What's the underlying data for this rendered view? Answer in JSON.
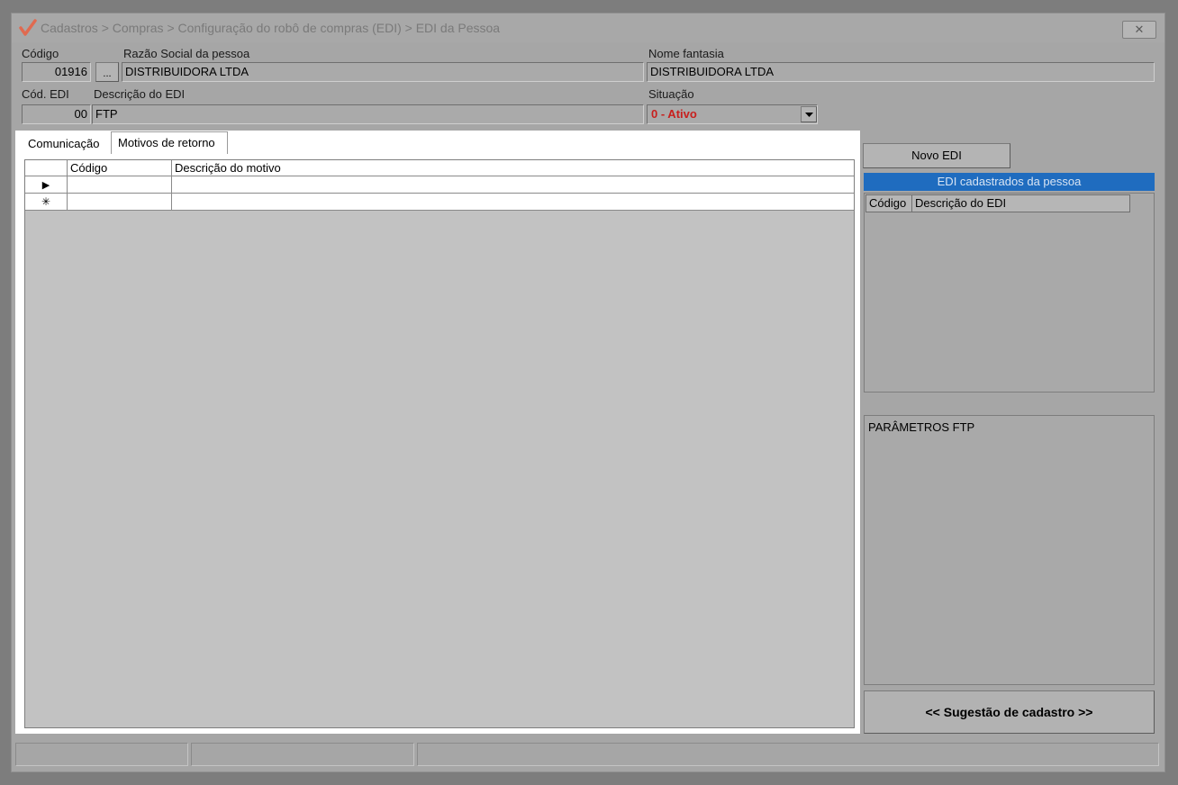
{
  "window": {
    "breadcrumb": "Cadastros > Compras > Configuração do robô de compras (EDI) > EDI da Pessoa",
    "close_label": "✕",
    "accent_color": "#e06a50"
  },
  "form": {
    "codigo_label": "Código",
    "codigo_value": "01916",
    "lookup_label": "...",
    "razao_label": "Razão Social da pessoa",
    "razao_value": "DISTRIBUIDORA LTDA",
    "fantasia_label": "Nome fantasia",
    "fantasia_value": "DISTRIBUIDORA LTDA",
    "cod_edi_label": "Cód. EDI",
    "cod_edi_value": "00",
    "desc_edi_label": "Descrição do EDI",
    "desc_edi_value": "FTP",
    "situacao_label": "Situação",
    "situacao_value": "0 - Ativo",
    "situacao_color": "#c8201e"
  },
  "tabs": [
    {
      "label": "Comunicação",
      "active": false
    },
    {
      "label": "Motivos de retorno",
      "active": true
    }
  ],
  "grid": {
    "columns": [
      "Código",
      "Descrição do motivo"
    ],
    "row_markers": [
      "▶",
      "✳"
    ]
  },
  "right_panel": {
    "novo_edi_label": "Novo EDI",
    "edi_list_title": "EDI cadastrados da pessoa",
    "edi_list_title_color": "#1f6cbf",
    "edi_list_columns": [
      "Código",
      "Descrição do EDI"
    ],
    "ftp_params_label": "PARÂMETROS FTP",
    "sugestao_label": "<< Sugestão de cadastro >>"
  }
}
